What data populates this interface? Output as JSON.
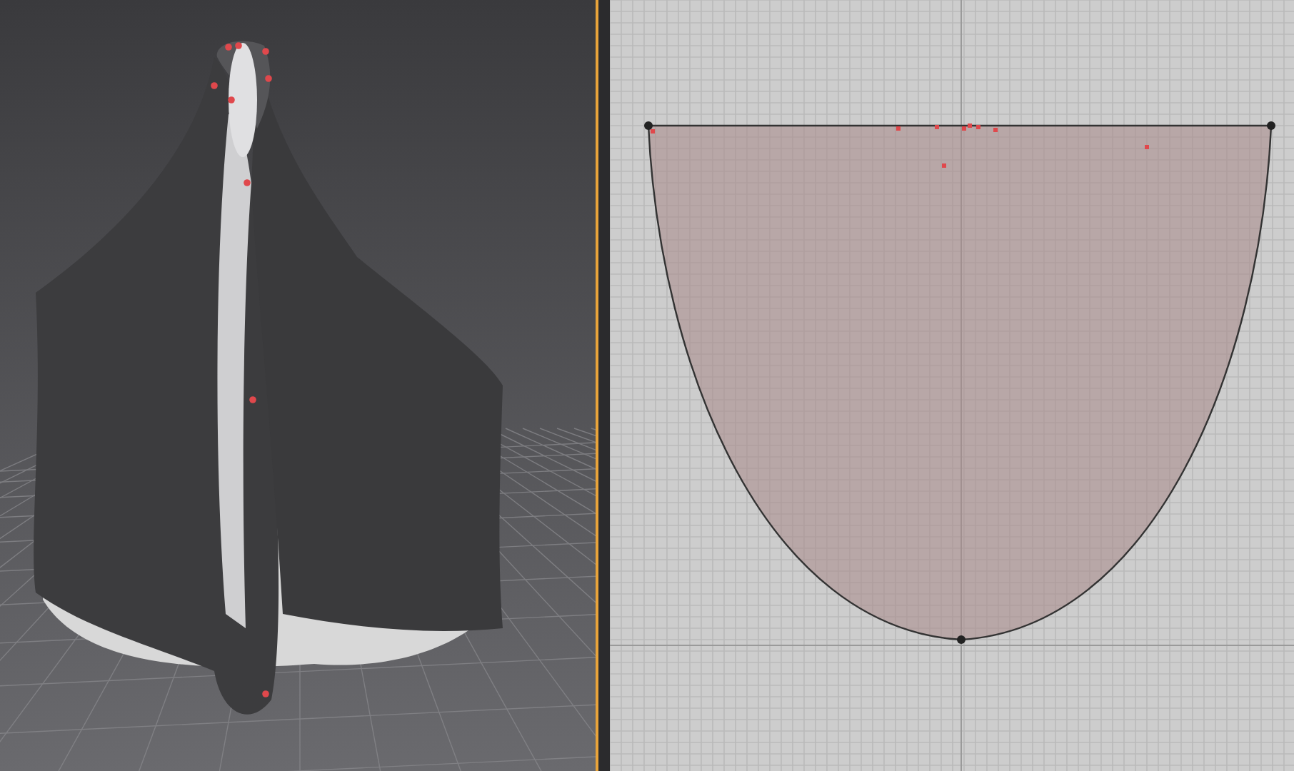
{
  "views": [
    {
      "kind": "avatar_3d",
      "selected": true
    },
    {
      "kind": "pattern_2d",
      "selected": false
    }
  ]
}
